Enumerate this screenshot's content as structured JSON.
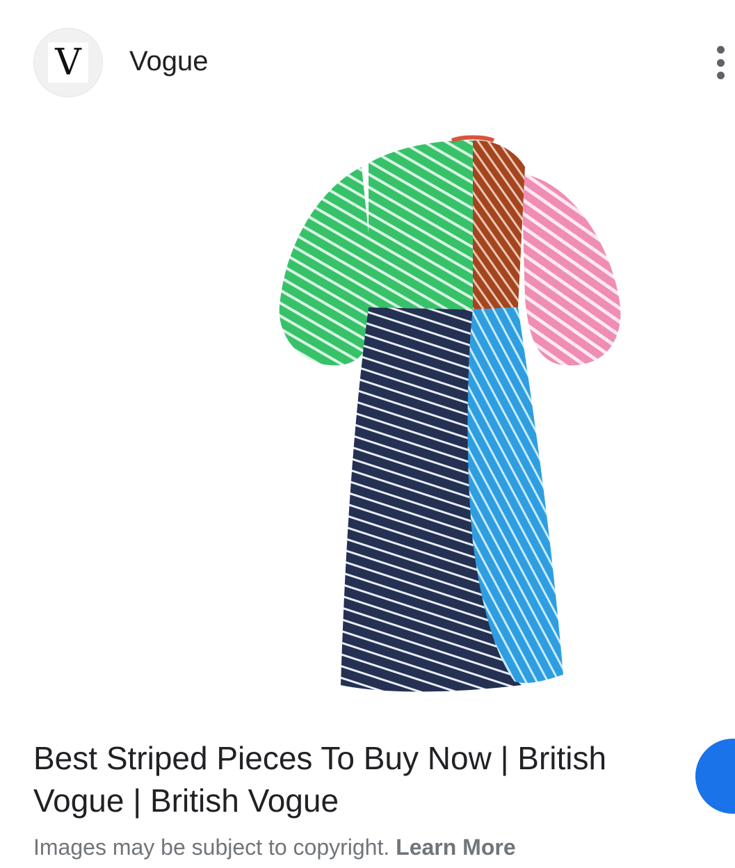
{
  "header": {
    "logo_letter": "V",
    "source_name": "Vogue",
    "more_icon": "more-vertical-icon"
  },
  "result": {
    "image_alt": "striped color-block dress",
    "title": "Best Striped Pieces To Buy Now | British Vogue | British Vogue",
    "copyright_text": "Images may be subject to copyright.",
    "learn_more_label": "Learn More"
  },
  "colors": {
    "text_primary": "#202124",
    "text_secondary": "#70757a",
    "accent": "#1a73e8"
  }
}
